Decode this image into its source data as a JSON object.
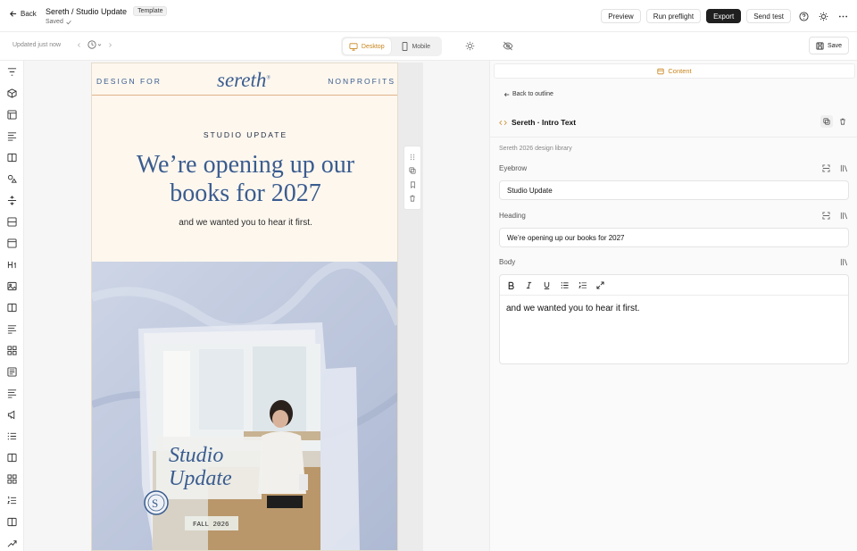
{
  "topbar": {
    "back_label": "Back",
    "doc_title": "Sereth / Studio Update",
    "template_tag": "Template",
    "saved_label": "Saved",
    "preview_label": "Preview",
    "preflight_label": "Run preflight",
    "export_label": "Export",
    "send_test_label": "Send test"
  },
  "subbar": {
    "updated_label": "Updated just now",
    "desktop_label": "Desktop",
    "mobile_label": "Mobile",
    "save_label": "Save"
  },
  "rail": {
    "icons": [
      "filter-icon",
      "cube-icon",
      "layout-icon",
      "text-left-icon",
      "book-icon",
      "shapes-icon",
      "divider-icon",
      "section-icon",
      "panel-icon",
      "heading-icon",
      "image-icon",
      "book-icon",
      "text-icon",
      "grid-icon",
      "newspaper-icon",
      "text-icon",
      "megaphone-icon",
      "list-icon",
      "book-icon",
      "grid-icon",
      "numbered-list-icon",
      "book-icon",
      "trend-icon"
    ]
  },
  "email": {
    "header_left": "DESIGN FOR",
    "logo": "sereth",
    "header_right": "NONPROFITS",
    "eyebrow": "STUDIO UPDATE",
    "heading": "We’re opening up our books for 2027",
    "body": "and we wanted you to hear it first.",
    "hero_title_1": "Studio",
    "hero_title_2": "Update",
    "hero_season": "FALL 2026",
    "hero_seal": "S"
  },
  "panel": {
    "content_tab": "Content",
    "back_to_outline": "Back to outline",
    "block_title": "Sereth · Intro Text",
    "library": "Sereth 2026 design library",
    "eyebrow_label": "Eyebrow",
    "eyebrow_value": "Studio Update",
    "heading_label": "Heading",
    "heading_value": "We’re opening up our books for 2027",
    "body_label": "Body",
    "body_value": "and we wanted you to hear it first."
  },
  "colors": {
    "accent": "#c8851c",
    "brand_blue": "#3a5c8f",
    "email_bg": "#fdf7ee",
    "export_bg": "#1f1f1f"
  }
}
